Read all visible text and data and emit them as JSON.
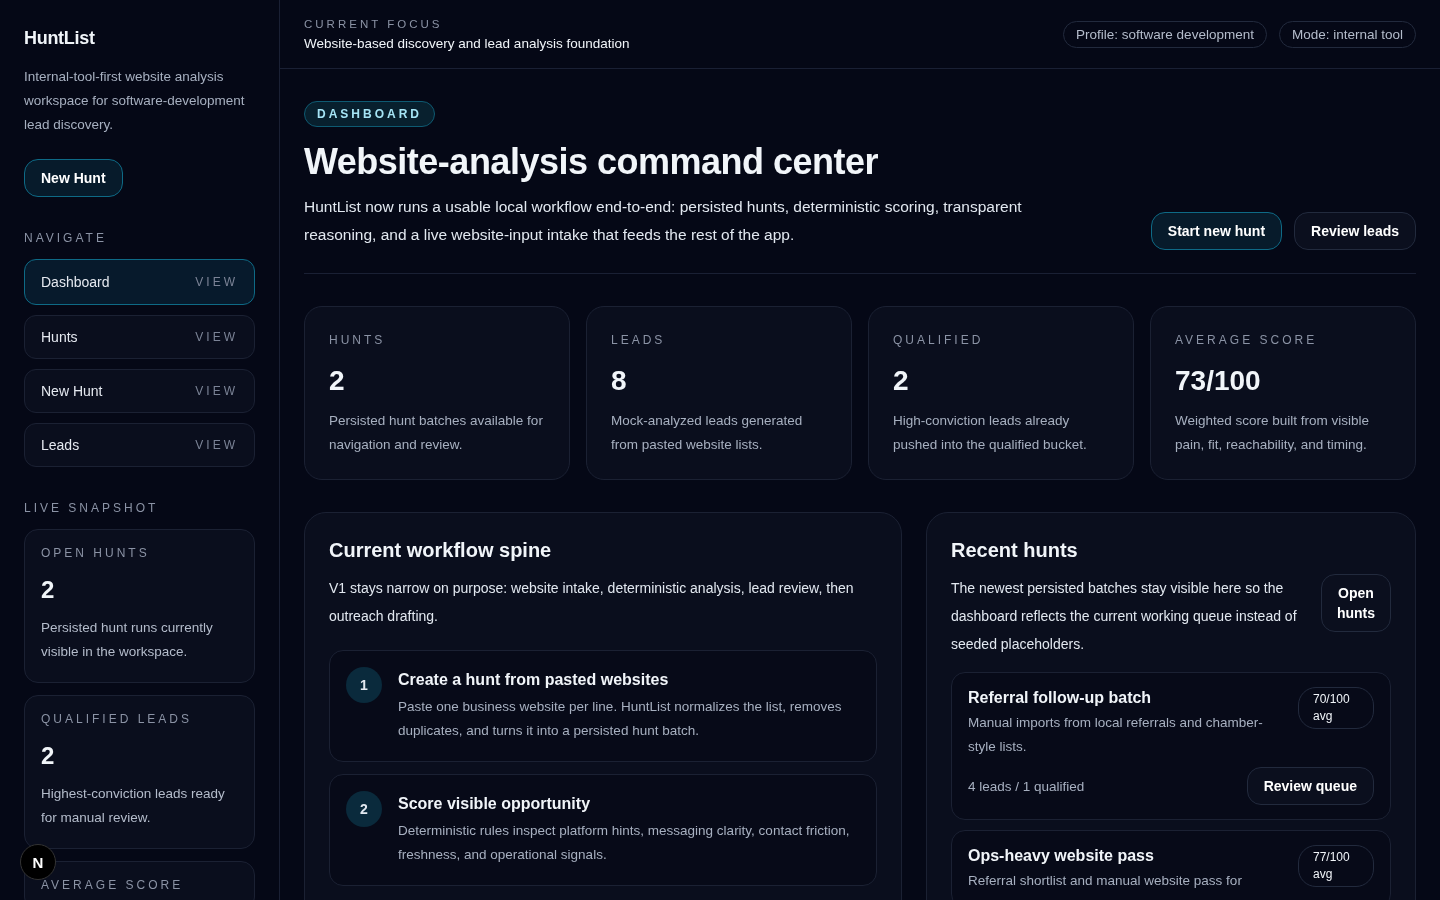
{
  "sidebar": {
    "brand": "HuntList",
    "tagline": "Internal-tool-first website analysis workspace for software-development lead discovery.",
    "cta": "New Hunt",
    "nav_heading": "NAVIGATE",
    "nav_items": [
      {
        "label": "Dashboard",
        "hint": "VIEW",
        "selected": true
      },
      {
        "label": "Hunts",
        "hint": "VIEW",
        "selected": false
      },
      {
        "label": "New Hunt",
        "hint": "VIEW",
        "selected": false
      },
      {
        "label": "Leads",
        "hint": "VIEW",
        "selected": false
      }
    ],
    "snapshot_heading": "LIVE SNAPSHOT",
    "snapshot_cards": [
      {
        "label": "OPEN HUNTS",
        "value": "2",
        "note": "Persisted hunt runs currently visible in the workspace."
      },
      {
        "label": "QUALIFIED LEADS",
        "value": "2",
        "note": "Highest-conviction leads ready for manual review."
      },
      {
        "label": "AVERAGE SCORE"
      }
    ]
  },
  "topbar": {
    "eyebrow": "CURRENT FOCUS",
    "focus": "Website-based discovery and lead analysis foundation",
    "pills": [
      "Profile: software development",
      "Mode: internal tool"
    ]
  },
  "hero": {
    "badge": "DASHBOARD",
    "title": "Website-analysis command center",
    "lead": "HuntList now runs a usable local workflow end-to-end: persisted hunts, deterministic scoring, transparent reasoning, and a live website-input intake that feeds the rest of the app.",
    "actions": [
      {
        "label": "Start new hunt",
        "kind": "primary"
      },
      {
        "label": "Review leads",
        "kind": "secondary"
      }
    ]
  },
  "stats": [
    {
      "label": "HUNTS",
      "value": "2",
      "note": "Persisted hunt batches available for navigation and review."
    },
    {
      "label": "LEADS",
      "value": "8",
      "note": "Mock-analyzed leads generated from pasted website lists."
    },
    {
      "label": "QUALIFIED",
      "value": "2",
      "note": "High-conviction leads already pushed into the qualified bucket."
    },
    {
      "label": "AVERAGE SCORE",
      "value": "73/100",
      "note": "Weighted score built from visible pain, fit, reachability, and timing."
    }
  ],
  "workflow": {
    "title": "Current workflow spine",
    "intro": "V1 stays narrow on purpose: website intake, deterministic analysis, lead review, then outreach drafting.",
    "steps": [
      {
        "number": "1",
        "title": "Create a hunt from pasted websites",
        "text": "Paste one business website per line. HuntList normalizes the list, removes duplicates, and turns it into a persisted hunt batch."
      },
      {
        "number": "2",
        "title": "Score visible opportunity",
        "text": "Deterministic rules inspect platform hints, messaging clarity, contact friction, freshness, and operational signals."
      }
    ]
  },
  "recent": {
    "title": "Recent hunts",
    "intro": "The newest persisted batches stay visible here so the dashboard reflects the current working queue instead of seeded placeholders.",
    "action": "Open hunts",
    "hunts": [
      {
        "name": "Referral follow-up batch",
        "score": "70/100 avg",
        "text": "Manual imports from local referrals and chamber-style lists.",
        "meta": "4 leads / 1 qualified",
        "action": "Review queue"
      },
      {
        "name": "Ops-heavy website pass",
        "score": "77/100 avg",
        "text": "Referral shortlist and manual website pass for"
      }
    ]
  },
  "dev_badge": "N"
}
